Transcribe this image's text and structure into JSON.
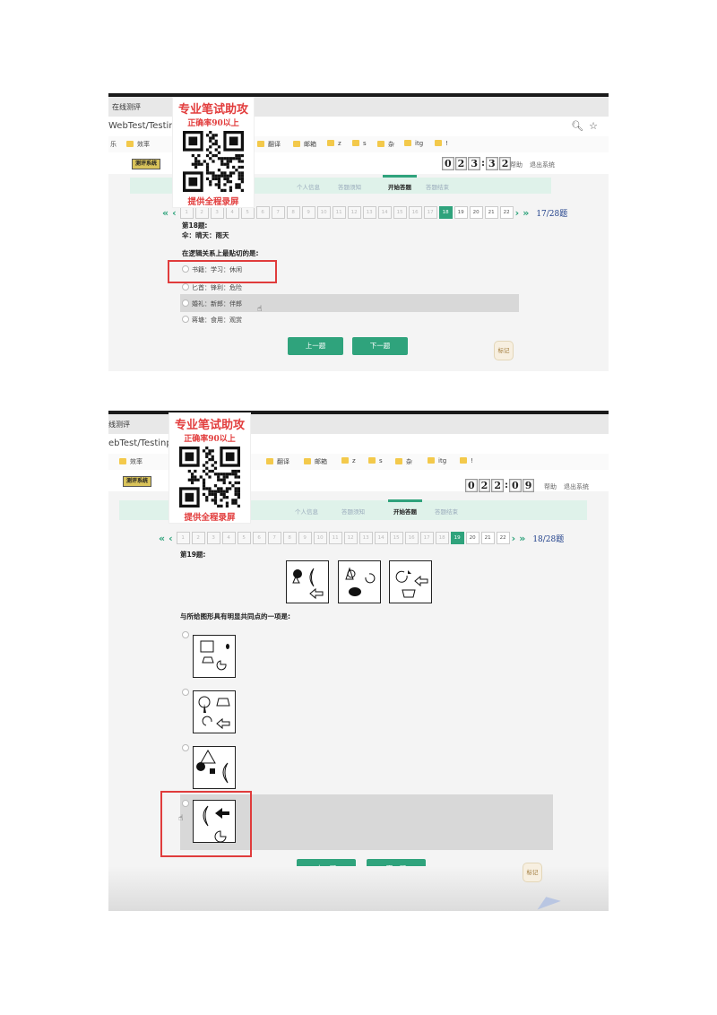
{
  "overlay": {
    "title": "专业笔试助攻",
    "accuracy": "正确率90以上",
    "footer": "提供全程录屏"
  },
  "shot1": {
    "tab_title": "在线测评",
    "address": "WebTest/Testinp",
    "bookmarks": [
      "乐",
      "效率",
      "翻译",
      "邮箱",
      "z",
      "s",
      "杂",
      "itg",
      "!"
    ],
    "logo_text": "测评系统",
    "timer": [
      "0",
      "2",
      "3",
      "3",
      "2"
    ],
    "help_link": "帮助",
    "exit_link": "退出系统",
    "steps": [
      "个人信息",
      "答题须知",
      "开始答题",
      "答题结束"
    ],
    "pages": [
      "1",
      "2",
      "3",
      "4",
      "5",
      "6",
      "7",
      "8",
      "9",
      "10",
      "11",
      "12",
      "13",
      "14",
      "15",
      "16",
      "17",
      "18",
      "19",
      "20",
      "21",
      "22"
    ],
    "current_page": 18,
    "page_count": "17/28题",
    "question_number": "第18题:",
    "question_stem": "伞：晴天：雨天",
    "question_prompt": "在逻辑关系上最贴切的是:",
    "options": [
      "书籍：学习：休闲",
      "匕首：锋利：危险",
      "婚礼：新郎：伴郎",
      "蒋塘：食用：观赏"
    ],
    "prev_button": "上一题",
    "next_button": "下一题",
    "mark_button": "标记"
  },
  "shot2": {
    "tab_title": "线测评",
    "address": "ebTest/Testinp",
    "bookmarks": [
      "效率",
      "翻译",
      "邮箱",
      "z",
      "s",
      "杂",
      "itg",
      "!"
    ],
    "logo_text": "测评系统",
    "timer": [
      "0",
      "2",
      "2",
      "0",
      "9"
    ],
    "help_link": "帮助",
    "exit_link": "退出系统",
    "steps": [
      "个人信息",
      "答题须知",
      "开始答题",
      "答题结束"
    ],
    "pages": [
      "1",
      "2",
      "3",
      "4",
      "5",
      "6",
      "7",
      "8",
      "9",
      "10",
      "11",
      "12",
      "13",
      "14",
      "15",
      "16",
      "17",
      "18",
      "19",
      "20",
      "21",
      "22"
    ],
    "current_page": 19,
    "page_count": "18/28题",
    "question_number": "第19题:",
    "question_prompt": "与所给图形具有明显共同点的一项是:",
    "prev_button": "上一题",
    "next_button": "下一题",
    "mark_button": "标记"
  },
  "colors": {
    "accent_green": "#2fa37c",
    "highlight_red": "#e03c3c",
    "step_band": "#dff2ea"
  }
}
